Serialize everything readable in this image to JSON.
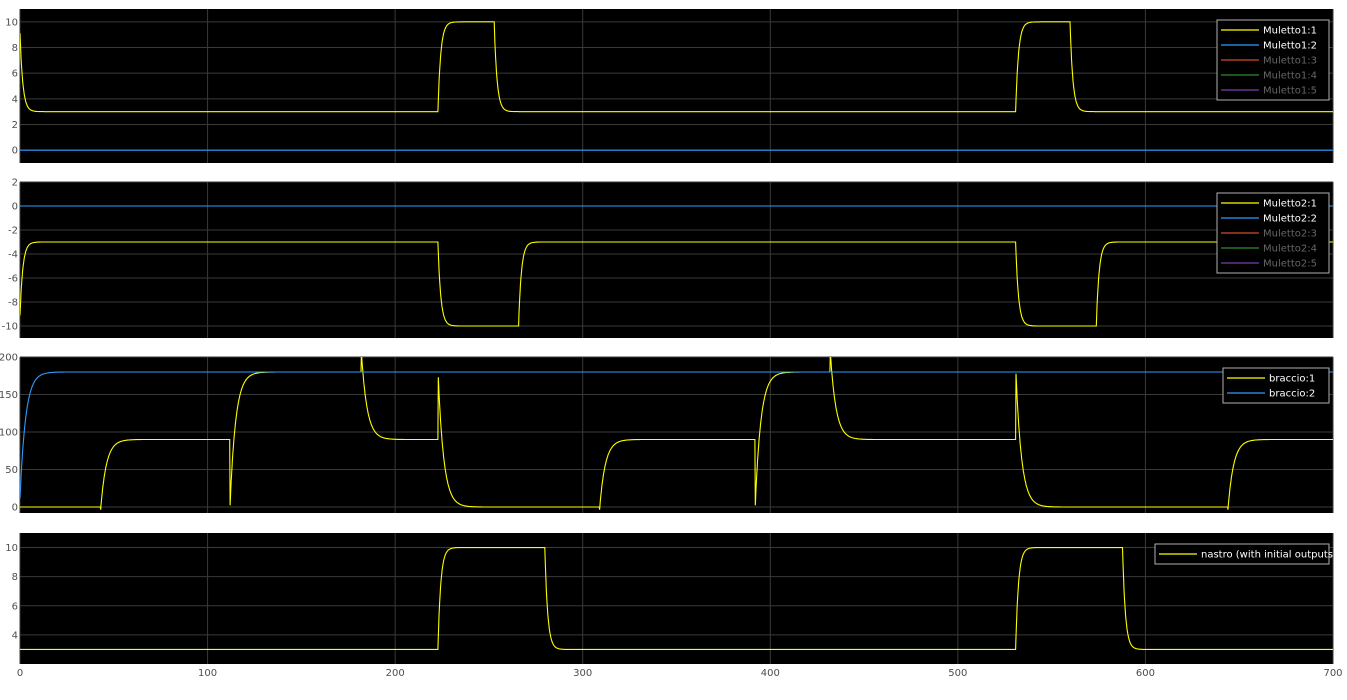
{
  "colors": {
    "background": "#ffffff",
    "axes_bg": "#000000",
    "grid": "#3a3a3a",
    "tick_label": "#4d4d4d",
    "legend_bg": "#000000",
    "legend_border": "#b0b0b0",
    "legend_text": "#ffffff",
    "legend_text_dim": "#666666",
    "yellow": "#ffff00",
    "blue": "#2e9cff",
    "red": "#d84a2a",
    "green": "#2e8b2e",
    "purple": "#7a3fb0"
  },
  "x_axis": {
    "range": [
      0,
      700
    ],
    "ticks": [
      0,
      100,
      200,
      300,
      400,
      500,
      600,
      700
    ]
  },
  "chart_data": [
    {
      "type": "line",
      "id": "muletto1",
      "ylim": [
        -1,
        11
      ],
      "yticks": [
        0,
        2,
        4,
        6,
        8,
        10
      ],
      "grid": true,
      "legend_position": "top-right",
      "series": [
        {
          "name": "Muletto1:1",
          "color": "#ffff00",
          "signal": {
            "initial": 10,
            "settle": 3,
            "tau": 1.5,
            "steps": [
              [
                223,
                10
              ],
              [
                253,
                3
              ],
              [
                531,
                10
              ],
              [
                560,
                3
              ]
            ]
          }
        },
        {
          "name": "Muletto1:2",
          "color": "#2e9cff",
          "signal": {
            "initial": 0,
            "settle": 0,
            "tau": 1.5,
            "steps": []
          }
        },
        {
          "name": "Muletto1:3",
          "color": "#d84a2a",
          "signal": null
        },
        {
          "name": "Muletto1:4",
          "color": "#2e8b2e",
          "signal": null
        },
        {
          "name": "Muletto1:5",
          "color": "#7a3fb0",
          "signal": null
        }
      ],
      "active_legend_entries": 2
    },
    {
      "type": "line",
      "id": "muletto2",
      "ylim": [
        -11,
        2
      ],
      "yticks": [
        -10,
        -8,
        -6,
        -4,
        -2,
        0,
        2
      ],
      "grid": true,
      "legend_position": "top-right",
      "series": [
        {
          "name": "Muletto2:1",
          "color": "#ffff00",
          "signal": {
            "initial": -10,
            "settle": -3,
            "tau": 1.5,
            "steps": [
              [
                223,
                -10
              ],
              [
                266,
                -3
              ],
              [
                531,
                -10
              ],
              [
                574,
                -3
              ]
            ]
          }
        },
        {
          "name": "Muletto2:2",
          "color": "#2e9cff",
          "signal": {
            "initial": 0,
            "settle": 0,
            "tau": 1.5,
            "steps": []
          }
        },
        {
          "name": "Muletto2:3",
          "color": "#d84a2a",
          "signal": null
        },
        {
          "name": "Muletto2:4",
          "color": "#2e8b2e",
          "signal": null
        },
        {
          "name": "Muletto2:5",
          "color": "#7a3fb0",
          "signal": null
        }
      ],
      "active_legend_entries": 2
    },
    {
      "type": "line",
      "id": "braccio",
      "ylim": [
        -8,
        200
      ],
      "yticks": [
        0,
        50,
        100,
        150,
        200
      ],
      "grid": true,
      "legend_position": "top-right",
      "series": [
        {
          "name": "braccio:1",
          "color": "#ffff00",
          "signal": {
            "initial": 0,
            "settle": 0,
            "tau": 3,
            "steps": [
              [
                43,
                90
              ],
              [
                112,
                180
              ],
              [
                182,
                90
              ],
              [
                223,
                0
              ],
              [
                309,
                90
              ],
              [
                392,
                180
              ],
              [
                432,
                90
              ],
              [
                531,
                0
              ],
              [
                644,
                90
              ]
            ],
            "dips": [
              [
                43,
                -10
              ],
              [
                112,
                -10
              ],
              [
                309,
                -10
              ],
              [
                392,
                -10
              ],
              [
                644,
                -10
              ]
            ],
            "spikes": [
              [
                182,
                215
              ],
              [
                223,
                185
              ],
              [
                432,
                215
              ],
              [
                531,
                190
              ]
            ]
          }
        },
        {
          "name": "braccio:2",
          "color": "#2e9cff",
          "signal": {
            "initial": 0,
            "settle": 180,
            "tau": 3,
            "steps": []
          }
        }
      ],
      "active_legend_entries": 2
    },
    {
      "type": "line",
      "id": "nastro",
      "ylim": [
        2,
        11
      ],
      "yticks": [
        4,
        6,
        8,
        10
      ],
      "grid": true,
      "legend_position": "top-right",
      "series": [
        {
          "name": "nastro (with initial outputs)",
          "color": "#ffff00",
          "signal": {
            "initial": 3,
            "settle": 3,
            "tau": 1.5,
            "steps": [
              [
                223,
                10
              ],
              [
                280,
                3
              ],
              [
                531,
                10
              ],
              [
                588,
                3
              ]
            ]
          }
        }
      ],
      "active_legend_entries": 1
    }
  ]
}
